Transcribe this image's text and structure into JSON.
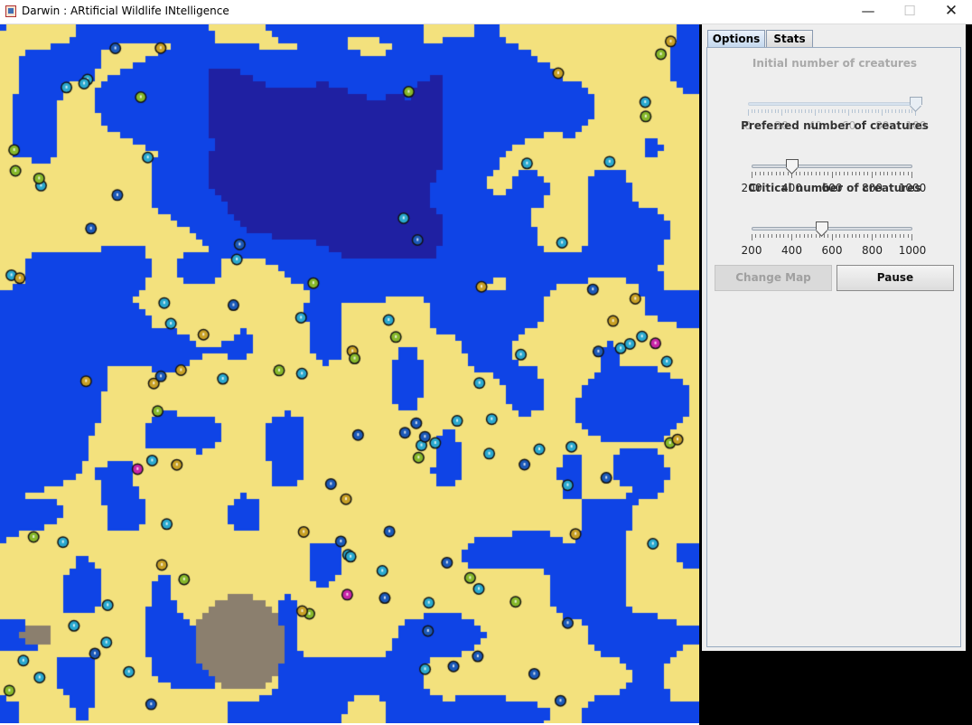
{
  "window": {
    "title": "Darwin : ARtificial Wildlife INtelligence",
    "icons": {
      "app": "java-cup-icon",
      "minimize": "minimize-icon",
      "maximize": "maximize-icon",
      "close": "close-icon"
    },
    "minimize_glyph": "—",
    "maximize_glyph": "☐",
    "close_glyph": "✕"
  },
  "tabs": [
    {
      "label": "Options",
      "selected": true
    },
    {
      "label": "Stats",
      "selected": false
    }
  ],
  "options": {
    "initial": {
      "label": "Initial number of creatures",
      "enabled": false,
      "min": 0,
      "max": 100,
      "value": 100,
      "tick_labels": [
        "0",
        "20",
        "40",
        "60",
        "80",
        "100"
      ]
    },
    "preferred": {
      "label": "Preferred number of creatures",
      "enabled": true,
      "min": 200,
      "max": 1000,
      "value": 400,
      "tick_labels": [
        "200",
        "400",
        "600",
        "800",
        "1000"
      ]
    },
    "critical": {
      "label": "Critical number of creatures",
      "enabled": true,
      "min": 200,
      "max": 1000,
      "value": 550,
      "tick_labels": [
        "200",
        "400",
        "600",
        "800",
        "1000"
      ]
    },
    "change_map_label": "Change Map",
    "change_map_enabled": false,
    "pause_label": "Pause"
  },
  "map": {
    "terrain_colors": {
      "deep_water": "#1f20a2",
      "water": "#0f44e6",
      "sand": "#f3e17d",
      "grass_light": "#1fae2c",
      "forest": "#1d8b34",
      "forest_dark": "#167a2e",
      "rock": "#8b7f6e"
    },
    "creature_colors": [
      "#2aa9cf",
      "#1b59b8",
      "#86b82a",
      "#c8a024",
      "#c925a8"
    ],
    "creature_count_visible": 196
  }
}
